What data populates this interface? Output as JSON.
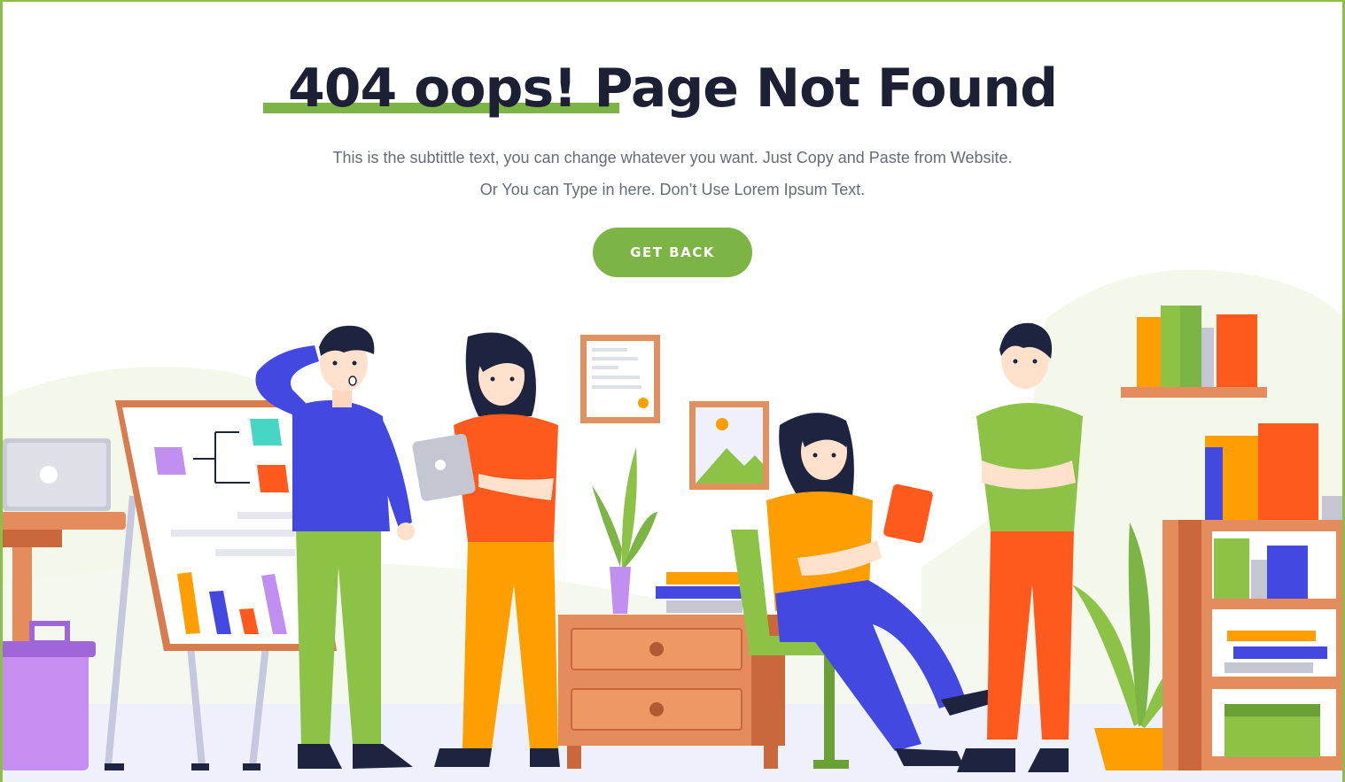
{
  "page": {
    "title": "404 oops!  Page Not Found",
    "subtitle_line1": "This is the subtittle text, you can change whatever you want. Just Copy and Paste from Website.",
    "subtitle_line2": "Or You can Type in here. Don’t Use Lorem Ipsum Text.",
    "button_label": "GET BACK"
  },
  "colors": {
    "accent": "#7cb546",
    "title": "#1d2035",
    "subtitle": "#666b78",
    "frame": "#8cbf4a"
  },
  "illustration": {
    "icons": [
      "laptop-icon",
      "whiteboard-icon",
      "certificate-icon",
      "landscape-picture-icon",
      "plant-icon",
      "bookshelf-icon",
      "cabinet-icon",
      "chair-icon",
      "trash-bin-icon"
    ]
  }
}
